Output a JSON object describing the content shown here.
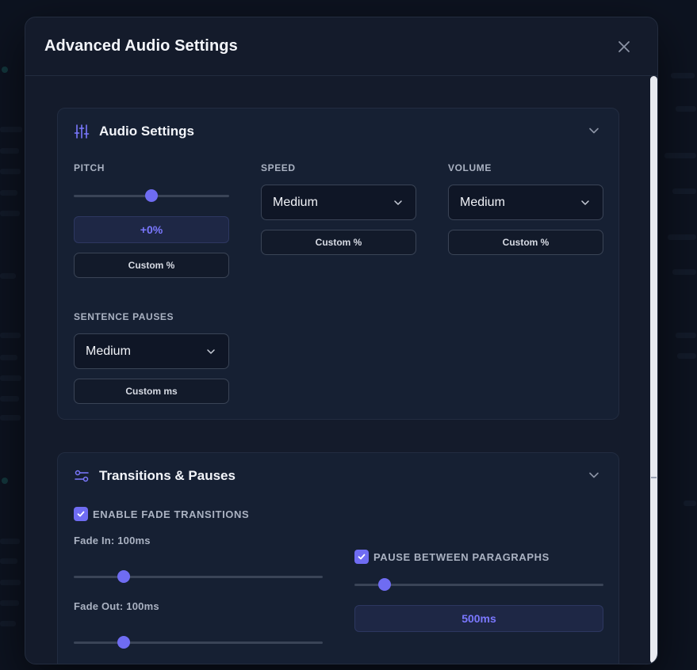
{
  "modal": {
    "title": "Advanced Audio Settings"
  },
  "audio_settings": {
    "title": "Audio Settings",
    "pitch": {
      "label": "PITCH",
      "value": "+0%",
      "slider_fraction": 0.5,
      "custom_label": "Custom %"
    },
    "speed": {
      "label": "SPEED",
      "selected": "Medium",
      "custom_label": "Custom %"
    },
    "volume": {
      "label": "VOLUME",
      "selected": "Medium",
      "custom_label": "Custom %"
    },
    "sentence_pauses": {
      "label": "SENTENCE PAUSES",
      "selected": "Medium",
      "custom_label": "Custom ms"
    }
  },
  "transitions": {
    "title": "Transitions & Pauses",
    "enable_fade": {
      "label": "ENABLE FADE TRANSITIONS",
      "checked": true
    },
    "fade_in": {
      "label": "Fade In: 100ms",
      "slider_fraction": 0.2
    },
    "fade_out": {
      "label": "Fade Out: 100ms",
      "slider_fraction": 0.2
    },
    "pause_between_paragraphs": {
      "label": "PAUSE BETWEEN PARAGRAPHS",
      "checked": true,
      "slider_fraction": 0.12,
      "value": "500ms"
    }
  },
  "colors": {
    "accent": "#6f6cf2",
    "modal_bg": "#141b2b",
    "section_bg": "#162033"
  },
  "icons": {
    "close": "close-icon",
    "sliders": "sliders-icon",
    "toggles": "toggles-icon",
    "chevron": "chevron-down-icon"
  }
}
